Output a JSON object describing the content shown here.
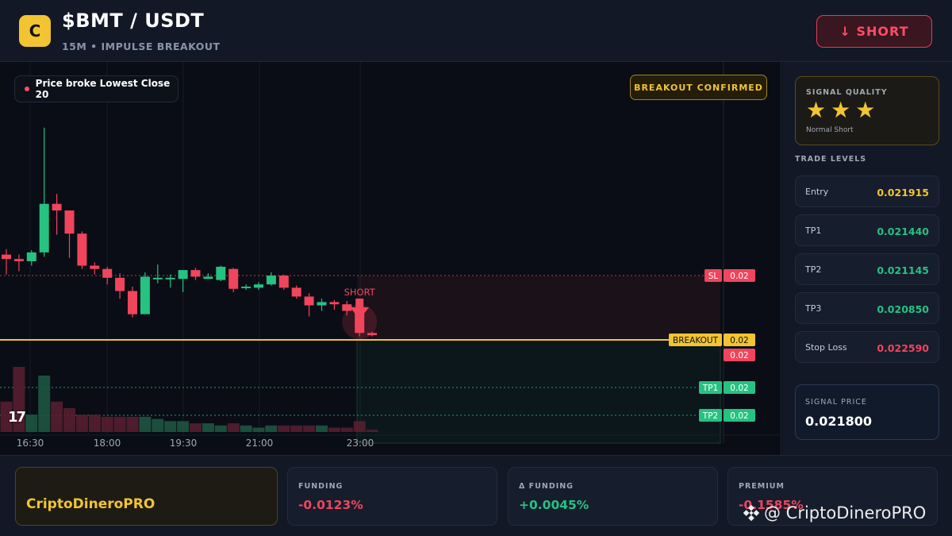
{
  "header": {
    "logo_letter": "C",
    "pair": "$BMT / USDT",
    "subtitle": "15M • IMPULSE BREAKOUT",
    "short_button": "↓ SHORT"
  },
  "chart": {
    "info_pill": "Price broke Lowest Close 20",
    "badge": "BREAKOUT CONFIRMED",
    "signal_label": "SHORT",
    "x_ticks": [
      "16:30",
      "18:00",
      "19:30",
      "21:00",
      "23:00"
    ],
    "price_tags": [
      {
        "label": "SL",
        "value": "0.02"
      },
      {
        "label": "BREAKOUT",
        "value": "0.02"
      },
      {
        "label": "",
        "value": "0.02"
      },
      {
        "label": "TP1",
        "value": "0.02"
      },
      {
        "label": "TP2",
        "value": "0.02"
      }
    ],
    "tv_mark": "17",
    "colors": {
      "up": "#26c281",
      "down": "#f0455c",
      "breakout": "#f2c431",
      "background": "#0a0d15"
    },
    "candles": [
      {
        "o": 0.02203,
        "h": 0.02208,
        "l": 0.02185,
        "c": 0.02199
      },
      {
        "o": 0.02199,
        "h": 0.02203,
        "l": 0.02188,
        "c": 0.02197
      },
      {
        "o": 0.02197,
        "h": 0.02207,
        "l": 0.02193,
        "c": 0.02205
      },
      {
        "o": 0.02205,
        "h": 0.02318,
        "l": 0.02201,
        "c": 0.02249
      },
      {
        "o": 0.02249,
        "h": 0.02258,
        "l": 0.02221,
        "c": 0.02243
      },
      {
        "o": 0.02243,
        "h": 0.02243,
        "l": 0.022,
        "c": 0.02222
      },
      {
        "o": 0.02222,
        "h": 0.02224,
        "l": 0.0219,
        "c": 0.02193
      },
      {
        "o": 0.02193,
        "h": 0.02196,
        "l": 0.02185,
        "c": 0.0219
      },
      {
        "o": 0.0219,
        "h": 0.02192,
        "l": 0.02176,
        "c": 0.02182
      },
      {
        "o": 0.02182,
        "h": 0.02186,
        "l": 0.02163,
        "c": 0.0217
      },
      {
        "o": 0.0217,
        "h": 0.02174,
        "l": 0.02146,
        "c": 0.02149
      },
      {
        "o": 0.02149,
        "h": 0.02187,
        "l": 0.02149,
        "c": 0.02183
      },
      {
        "o": 0.02181,
        "h": 0.02194,
        "l": 0.02177,
        "c": 0.02182
      },
      {
        "o": 0.02181,
        "h": 0.02185,
        "l": 0.02173,
        "c": 0.02182
      },
      {
        "o": 0.02181,
        "h": 0.02189,
        "l": 0.02169,
        "c": 0.02189
      },
      {
        "o": 0.02189,
        "h": 0.02191,
        "l": 0.0218,
        "c": 0.02183
      },
      {
        "o": 0.02181,
        "h": 0.02186,
        "l": 0.02181,
        "c": 0.02183
      },
      {
        "o": 0.0218,
        "h": 0.02193,
        "l": 0.02179,
        "c": 0.02192
      },
      {
        "o": 0.0219,
        "h": 0.02191,
        "l": 0.02169,
        "c": 0.02172
      },
      {
        "o": 0.02173,
        "h": 0.02176,
        "l": 0.02171,
        "c": 0.02174
      },
      {
        "o": 0.02173,
        "h": 0.02178,
        "l": 0.02171,
        "c": 0.02176
      },
      {
        "o": 0.02176,
        "h": 0.02187,
        "l": 0.02175,
        "c": 0.02184
      },
      {
        "o": 0.02184,
        "h": 0.02185,
        "l": 0.02171,
        "c": 0.02173
      },
      {
        "o": 0.02173,
        "h": 0.02175,
        "l": 0.02163,
        "c": 0.02165
      },
      {
        "o": 0.02165,
        "h": 0.02168,
        "l": 0.02147,
        "c": 0.02157
      },
      {
        "o": 0.02157,
        "h": 0.02163,
        "l": 0.02152,
        "c": 0.0216
      },
      {
        "o": 0.0216,
        "h": 0.02162,
        "l": 0.02153,
        "c": 0.02158
      },
      {
        "o": 0.02158,
        "h": 0.02161,
        "l": 0.02148,
        "c": 0.02152
      },
      {
        "o": 0.02152,
        "h": 0.02158,
        "l": 0.02129,
        "c": 0.02132
      },
      {
        "o": 0.02132,
        "h": 0.02133,
        "l": 0.02129,
        "c": 0.0213
      }
    ],
    "volumes": [
      14,
      30,
      8,
      26,
      14,
      11,
      8,
      8,
      7,
      7,
      7,
      7,
      6,
      5,
      5,
      4,
      4,
      3,
      4,
      3,
      2,
      3,
      3,
      3,
      3,
      3,
      2,
      2,
      5,
      1
    ]
  },
  "side": {
    "quality_title": "SIGNAL QUALITY",
    "stars": 3,
    "star_glyph": "★",
    "quality_label": "Normal Short",
    "levels_title": "TRADE LEVELS",
    "levels": [
      {
        "name": "Entry",
        "value": "0.021915",
        "color": "#f2c431"
      },
      {
        "name": "TP1",
        "value": "0.021440",
        "color": "#26c281"
      },
      {
        "name": "TP2",
        "value": "0.021145",
        "color": "#26c281"
      },
      {
        "name": "TP3",
        "value": "0.020850",
        "color": "#26c281"
      },
      {
        "name": "Stop Loss",
        "value": "0.022590",
        "color": "#f0455c"
      }
    ],
    "signal_price_title": "SIGNAL PRICE",
    "signal_price": "0.021800"
  },
  "footer": {
    "brand": "CriptoDineroPRO",
    "metrics": [
      {
        "label": "FUNDING",
        "value": "-0.0123%",
        "color": "#f0455c"
      },
      {
        "label": "Δ FUNDING",
        "value": "+0.0045%",
        "color": "#26c281"
      },
      {
        "label": "PREMIUM",
        "value": "-0.1585%",
        "color": "#f0455c"
      }
    ],
    "watermark": "@ CriptoDineroPRO"
  }
}
